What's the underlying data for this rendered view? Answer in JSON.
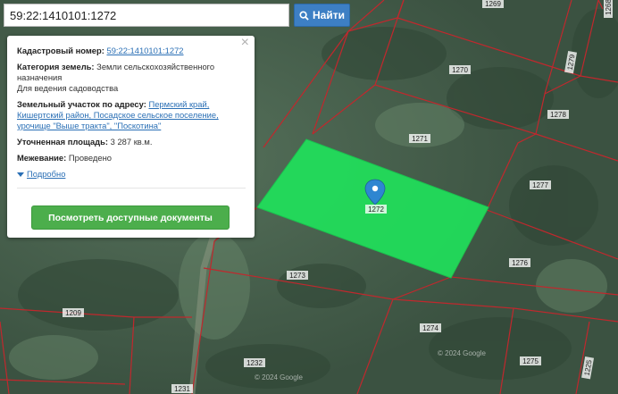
{
  "search": {
    "value": "59:22:1410101:1272",
    "button_label": "Найти"
  },
  "popup": {
    "cadastral_label": "Кадастровый номер:",
    "cadastral_value": "59:22:1410101:1272",
    "category_label": "Категория земель:",
    "category_value": "Земли сельскохозяйственного назначения",
    "usage_value": "Для ведения садоводства",
    "address_label": "Земельный участок по адресу:",
    "address_line1": "Пермский край,",
    "address_line2": "Кишертский район, Посадское сельское поселение,",
    "address_line3": "урочище \"Выше тракта\", \"Поскотина\"",
    "area_label": "Уточненная площадь:",
    "area_value": "3 287 кв.м.",
    "survey_label": "Межевание:",
    "survey_value": "Проведено",
    "more_label": "Подробно",
    "docs_button": "Посмотреть доступные документы",
    "close_symbol": "×"
  },
  "map": {
    "parcel_color": "#1fe35b",
    "boundary_color": "#c0282d",
    "parcel_labels": [
      {
        "id": "l1269",
        "text": "1269"
      },
      {
        "id": "l1268",
        "text": "1268"
      },
      {
        "id": "l1270",
        "text": "1270"
      },
      {
        "id": "l1279",
        "text": "1279"
      },
      {
        "id": "l1278",
        "text": "1278"
      },
      {
        "id": "l1271",
        "text": "1271"
      },
      {
        "id": "l1277",
        "text": "1277"
      },
      {
        "id": "l1276",
        "text": "1276"
      },
      {
        "id": "l1273",
        "text": "1273"
      },
      {
        "id": "l1274",
        "text": "1274"
      },
      {
        "id": "l1209",
        "text": "1209"
      },
      {
        "id": "l1232",
        "text": "1232"
      },
      {
        "id": "l1275",
        "text": "1275"
      },
      {
        "id": "l1231",
        "text": "1231"
      },
      {
        "id": "l1272",
        "text": "1272"
      },
      {
        "id": "l1225",
        "text": "1225"
      }
    ],
    "watermarks": [
      "© 2024 Google",
      "© 2024 Google"
    ]
  }
}
